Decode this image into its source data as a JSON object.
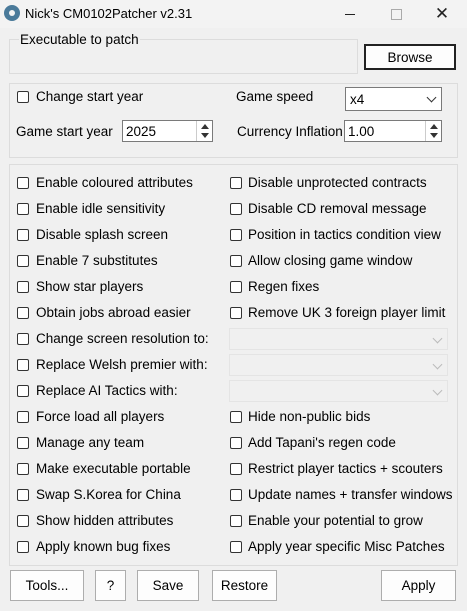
{
  "window": {
    "title": "Nick's CM0102Patcher v2.31",
    "close_glyph": "✕"
  },
  "executable": {
    "group_label": "Executable to patch",
    "browse_label": "Browse"
  },
  "options": {
    "change_start_year": "Change start year",
    "game_start_year_label": "Game start year",
    "game_start_year_value": "2025",
    "game_speed_label": "Game speed",
    "game_speed_value": "x4",
    "currency_inflation_label": "Currency Inflation",
    "currency_inflation_value": "1.00"
  },
  "left_checks": [
    "Enable coloured attributes",
    "Enable idle sensitivity",
    "Disable splash screen",
    "Enable 7 substitutes",
    "Show star players",
    "Obtain jobs abroad easier",
    "Change screen resolution to:",
    "Replace Welsh premier with:",
    "Replace AI Tactics with:",
    "Force load all players",
    "Manage any team",
    "Make executable portable",
    "Swap S.Korea for China",
    "Show hidden attributes",
    "Apply known bug fixes"
  ],
  "right_checks": [
    "Disable unprotected contracts",
    "Disable CD removal message",
    "Position in tactics condition view",
    "Allow closing game window",
    "Regen fixes",
    "Remove UK 3 foreign player limit",
    "",
    "",
    "",
    "Hide non-public bids",
    "Add Tapani's regen code",
    "Restrict player tactics + scouters",
    "Update names + transfer windows",
    "Enable your potential to grow",
    "Apply year specific Misc Patches"
  ],
  "footer": {
    "tools": "Tools...",
    "help": "?",
    "save": "Save",
    "restore": "Restore",
    "apply": "Apply"
  }
}
